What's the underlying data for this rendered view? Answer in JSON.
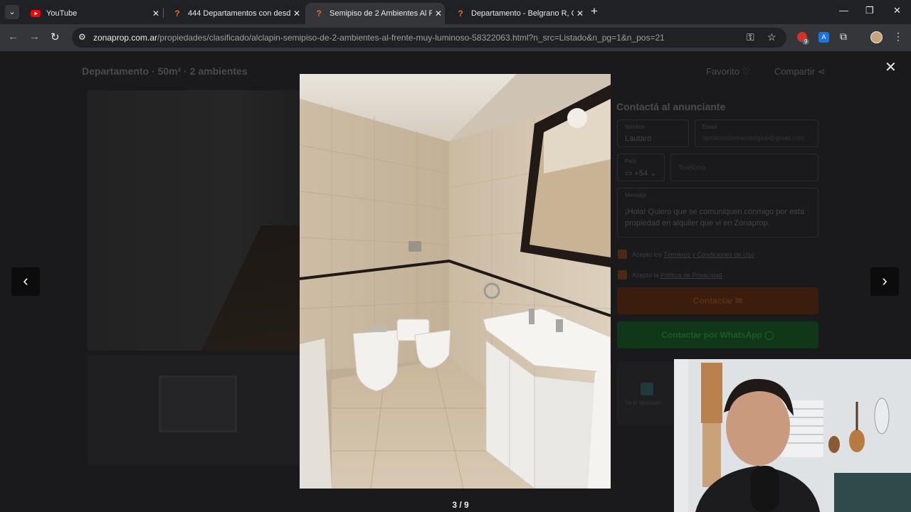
{
  "tabs": [
    {
      "title": "YouTube",
      "icon": "youtube-icon"
    },
    {
      "title": "444 Departamentos con desde",
      "icon": "zonaprop-icon"
    },
    {
      "title": "Semipiso de 2 Ambientes Al Fre",
      "icon": "zonaprop-icon"
    },
    {
      "title": "Departamento - Belgrano R, Ca",
      "icon": "zonaprop-icon"
    }
  ],
  "address_bar": {
    "host": "zonaprop.com.ar",
    "path": "/propiedades/clasificado/alclapin-semipiso-de-2-ambientes-al-frente-muy-luminoso-58322063.html?n_src=Listado&n_pg=1&n_pos=21"
  },
  "extensions": {
    "badge": "9",
    "translate_label": "A"
  },
  "listing": {
    "title": "Departamento · 50m² · 2 ambientes",
    "favorite": "Favorito",
    "share": "Compartir"
  },
  "contact_form": {
    "title": "Contactá al anunciante",
    "name_label": "Nombre",
    "name_value": "Lautaro",
    "email_label": "Email",
    "email_placeholder": "lautaroochomenadigital@gmail.com",
    "country_label": "País",
    "country_code": "+54",
    "phone_placeholder": "Teléfono",
    "message_label": "Mensaje",
    "message_text": "¡Hola! Quiero que se comuniquen conmigo por esta propiedad en alquiler que vi en Zonaprop.",
    "terms_prefix": "Acepto los ",
    "terms_link": "Términos y Condiciones de Uso",
    "privacy_prefix": "Acepto la ",
    "privacy_link": "Política de Privacidad",
    "contact_button": "Contactar",
    "whatsapp_button": "Contactar por WhatsApp",
    "card_label": "Ya el Mercado"
  },
  "gallery": {
    "counter": "3 / 9",
    "prev_label": "‹",
    "next_label": "›",
    "close_label": "✕"
  },
  "colors": {
    "overlay": "#1a1a1c",
    "contact_orange": "#3a1d0d",
    "whatsapp_green": "#113719"
  }
}
